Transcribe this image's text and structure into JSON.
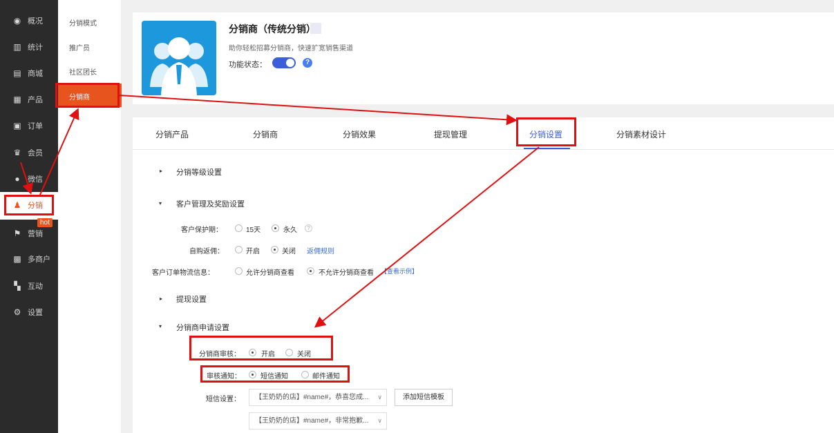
{
  "nav": {
    "items": [
      {
        "label": "概况",
        "icon": "dashboard-icon"
      },
      {
        "label": "统计",
        "icon": "stats-icon"
      },
      {
        "label": "商城",
        "icon": "store-icon"
      },
      {
        "label": "产品",
        "icon": "product-icon"
      },
      {
        "label": "订单",
        "icon": "order-icon"
      },
      {
        "label": "会员",
        "icon": "member-icon"
      },
      {
        "label": "微信",
        "icon": "wechat-icon"
      },
      {
        "label": "分销",
        "icon": "distribution-icon"
      },
      {
        "label": "营销",
        "icon": "marketing-icon"
      },
      {
        "label": "多商户",
        "icon": "multi-merchant-icon"
      },
      {
        "label": "互动",
        "icon": "interaction-icon"
      },
      {
        "label": "设置",
        "icon": "settings-icon"
      }
    ],
    "hot_badge": "hot",
    "accent_color": "#e8541e"
  },
  "subnav": {
    "items": [
      "分销模式",
      "推广员",
      "社区团长",
      "分销商"
    ]
  },
  "header": {
    "title": "分销商（传统分销）",
    "subtitle": "助你轻松招募分销商，快速扩宽销售渠道",
    "status_label": "功能状态：",
    "status_on": true,
    "help": "?"
  },
  "tabs": [
    "分销产品",
    "分销商",
    "分销效果",
    "提现管理",
    "分销设置",
    "分销素材设计"
  ],
  "active_tab": "分销设置",
  "sections": {
    "level": "分销等级设置",
    "customer": "客户管理及奖励设置",
    "withdraw": "提现设置",
    "apply": "分销商申请设置"
  },
  "customer": {
    "protect_label": "客户保护期：",
    "protect_opt1": "15天",
    "protect_opt2": "永久",
    "selfbuy_label": "自购返佣：",
    "selfbuy_opt1": "开启",
    "selfbuy_opt2": "关闭",
    "selfbuy_link": "返佣规则",
    "logistics_label": "客户订单物流信息：",
    "logistics_opt1": "允许分销商查看",
    "logistics_opt2": "不允许分销商查看",
    "logistics_link": "【查看示例】"
  },
  "apply": {
    "review_label": "分销商审核：",
    "review_opt1": "开启",
    "review_opt2": "关闭",
    "notify_label": "审核通知：",
    "notify_opt1": "短信通知",
    "notify_opt2": "邮件通知",
    "sms_label": "短信设置：",
    "sms_select1": "【王奶奶的店】#name#，恭喜您成...",
    "sms_select2": "【王奶奶的店】#name#，非常抱歉...",
    "add_template": "添加短信模板"
  },
  "annotation_color": "#e01010"
}
